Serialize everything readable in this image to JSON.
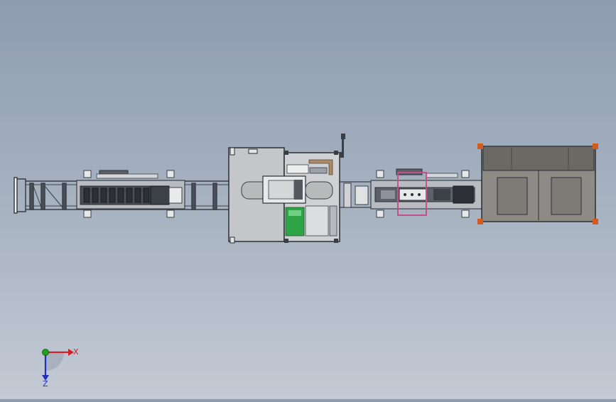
{
  "triad": {
    "x_label": "X",
    "z_label": "Z",
    "x_color": "#d0202a",
    "y_color": "#1fa01f",
    "z_color": "#2030c0"
  },
  "colors": {
    "frame_dark": "#3a3f47",
    "panel_grey": "#c4c6c9",
    "cabinet_brown": "#6a6964",
    "cabinet_inner": "#8c8b86",
    "accent_green": "#2fa447",
    "selection_magenta": "#c4508c",
    "corner_orange": "#d45a1e"
  }
}
